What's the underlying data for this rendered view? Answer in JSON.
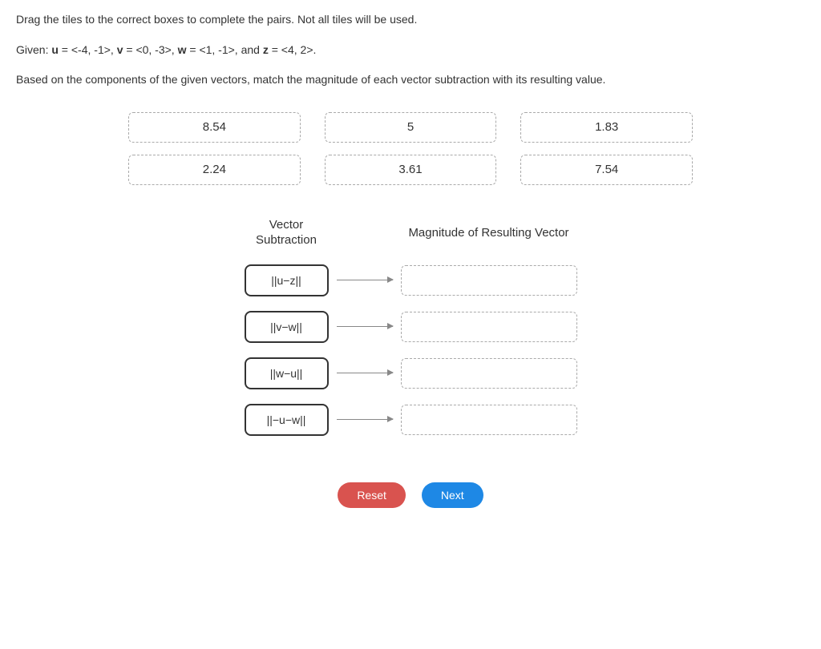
{
  "instructions": "Drag the tiles to the correct boxes to complete the pairs. Not all tiles will be used.",
  "given": {
    "prefix": "Given: ",
    "u_label": "u",
    "u_val": " = <-4, -1>, ",
    "v_label": "v",
    "v_val": " = <0, -3>, ",
    "w_label": "w",
    "w_val": " = <1, -1>, and ",
    "z_label": "z",
    "z_val": " = <4, 2>."
  },
  "prompt": "Based on the components of the given vectors, match the magnitude of each vector subtraction with its resulting value.",
  "tiles": {
    "row1": [
      "8.54",
      "5",
      "1.83"
    ],
    "row2": [
      "2.24",
      "3.61",
      "7.54"
    ]
  },
  "headers": {
    "left_line1": "Vector",
    "left_line2": "Subtraction",
    "right": "Magnitude of Resulting Vector"
  },
  "expressions": [
    "||u−z||",
    "||v−w||",
    "||w−u||",
    "||−u−w||"
  ],
  "buttons": {
    "reset": "Reset",
    "next": "Next"
  }
}
